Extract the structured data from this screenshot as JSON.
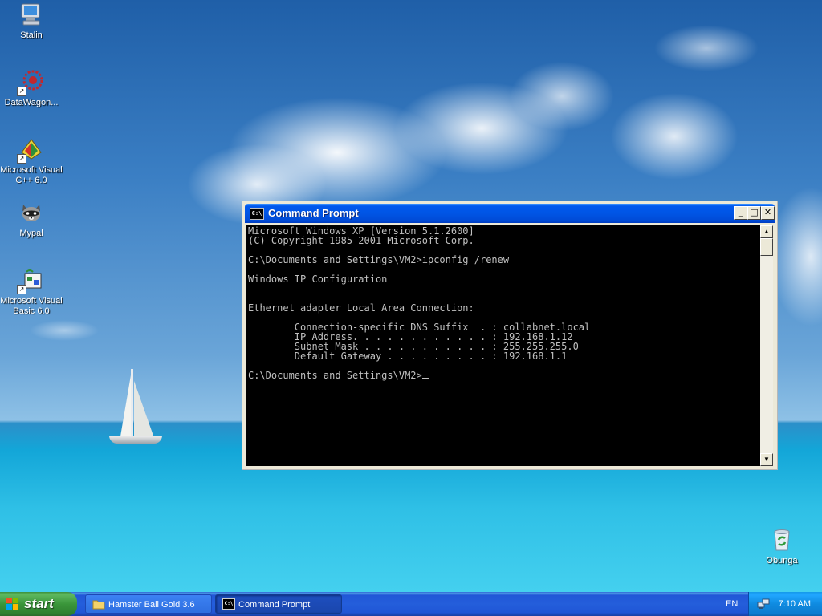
{
  "desktop": {
    "icons": [
      {
        "label": "Stalin",
        "icon": "computer-icon"
      },
      {
        "label": "DataWagon...",
        "icon": "datawagon-icon"
      },
      {
        "label": "Microsoft Visual C++ 6.0",
        "icon": "visual-cpp-icon"
      },
      {
        "label": "Mypal",
        "icon": "mypal-raccoon-icon"
      },
      {
        "label": "Microsoft Visual Basic 6.0",
        "icon": "visual-basic-icon"
      },
      {
        "label": "Obunga",
        "icon": "recycle-bin-icon"
      }
    ]
  },
  "window": {
    "title": "Command Prompt",
    "icon_text": "C:\\",
    "buttons": {
      "minimize": "_",
      "maximize": "□",
      "close": "✕"
    },
    "console_lines": [
      "Microsoft Windows XP [Version 5.1.2600]",
      "(C) Copyright 1985-2001 Microsoft Corp.",
      "",
      "C:\\Documents and Settings\\VM2>ipconfig /renew",
      "",
      "Windows IP Configuration",
      "",
      "",
      "Ethernet adapter Local Area Connection:",
      "",
      "        Connection-specific DNS Suffix  . : collabnet.local",
      "        IP Address. . . . . . . . . . . . : 192.168.1.12",
      "        Subnet Mask . . . . . . . . . . . : 255.255.255.0",
      "        Default Gateway . . . . . . . . . : 192.168.1.1",
      "",
      "C:\\Documents and Settings\\VM2>"
    ]
  },
  "taskbar": {
    "start_label": "start",
    "tasks": [
      {
        "label": "Hamster Ball Gold 3.6",
        "icon": "folder-icon",
        "active": false
      },
      {
        "label": "Command Prompt",
        "icon": "cmd-icon",
        "active": true
      }
    ],
    "language": "EN",
    "clock": "7:10 AM"
  },
  "colors": {
    "console_bg": "#000000",
    "console_fg": "#c0c0c0",
    "titlebar_blue": "#0055e5",
    "start_green": "#3a963a",
    "taskbar_blue": "#245edb"
  }
}
